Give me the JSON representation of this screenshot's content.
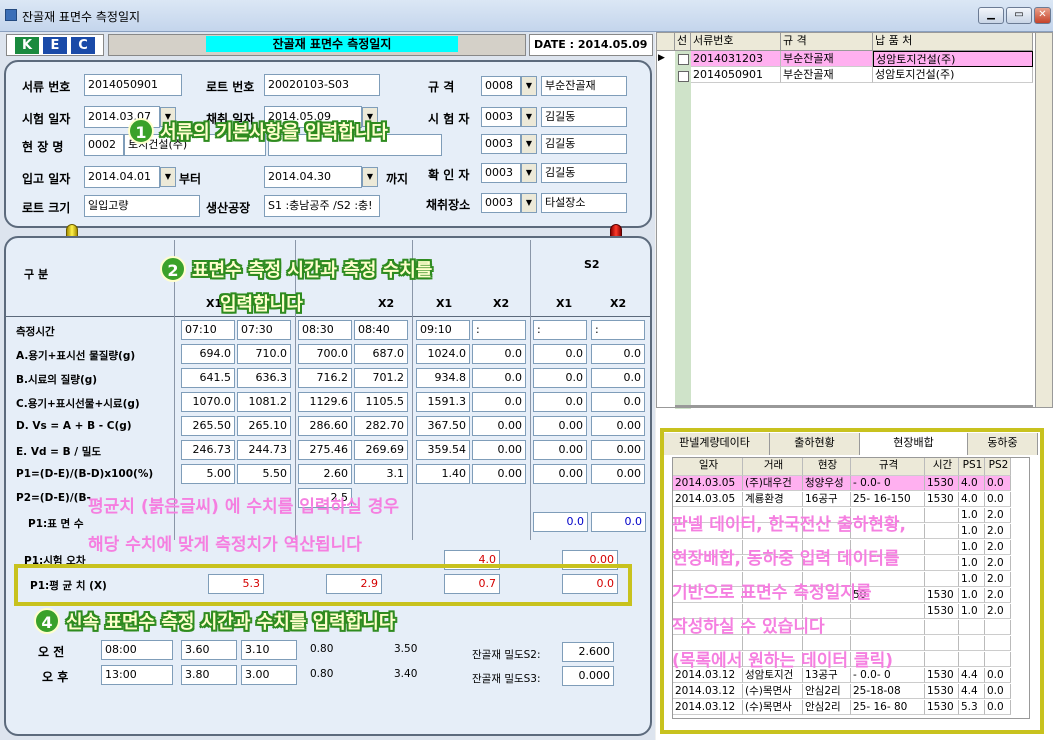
{
  "window": {
    "title": "잔골재 표면수 측정일지",
    "min": "▁",
    "max": "▭",
    "close": "✕"
  },
  "logo": {
    "k": "K",
    "e": "E",
    "c": "C",
    "colors": [
      "#1a8a3e",
      "#1a4aa8",
      "#1a4aa8"
    ]
  },
  "header": {
    "title": "잔골재 표면수 측정일지",
    "date": "DATE : 2014.05.09"
  },
  "form": {
    "doc_no_label": "서류 번호",
    "doc_no": "2014050901",
    "lot_no_label": "로트 번호",
    "lot_no": "20020103-S03",
    "spec_label": "규    격",
    "spec_code": "0008",
    "spec_name": "부순잔골재",
    "test_date_label": "시험 일자",
    "test_date": "2014.03.07",
    "cut_label": "채취 일자",
    "cut_date": "2014.05.09",
    "tester_label": "시 험 자",
    "tester_code": "0003",
    "tester_name": "김길동",
    "site_label": "현 장 명",
    "site_code": "0002",
    "site_name": "토지건설(주)",
    "checker_code": "0003",
    "checker_name": "김길동",
    "in_date_label": "입고 일자",
    "in_from": "2014.04.01",
    "from_label": "부터",
    "in_to": "2014.04.30",
    "to_label": "까지",
    "confirm_label": "확 인 자",
    "confirm_code": "0003",
    "confirm_name": "김길동",
    "lot_size_label": "로트 크기",
    "lot_size": "일입고량",
    "factory_label": "생산공장",
    "factory": "S1 :충남공주 /S2 :충!",
    "place_label": "채취장소",
    "place_code": "0003",
    "place_name": "타설장소"
  },
  "table": {
    "gubun_label": "구    분",
    "col_x1": "X1",
    "col_x2": "X2",
    "col_s": "S",
    "col_s2": "S2",
    "rows": [
      {
        "label": "측정시간",
        "v": [
          "07:10",
          "07:30",
          "08:30",
          "08:40",
          "09:10",
          ":",
          ":",
          ":"
        ]
      },
      {
        "label": "A.용기+표시선 물질량(g)",
        "v": [
          "694.0",
          "710.0",
          "700.0",
          "687.0",
          "1024.0",
          "0.0",
          "0.0",
          "0.0"
        ]
      },
      {
        "label": "B.시료의 질량(g)",
        "v": [
          "641.5",
          "636.3",
          "716.2",
          "701.2",
          "934.8",
          "0.0",
          "0.0",
          "0.0"
        ]
      },
      {
        "label": "C.용기+표시선물+시료(g)",
        "v": [
          "1070.0",
          "1081.2",
          "1129.6",
          "1105.5",
          "1591.3",
          "0.0",
          "0.0",
          "0.0"
        ]
      },
      {
        "label": "D. Vs = A + B - C(g)",
        "v": [
          "265.50",
          "265.10",
          "286.60",
          "282.70",
          "367.50",
          "0.00",
          "0.00",
          "0.00"
        ]
      },
      {
        "label": "E. Vd = B / 밀도",
        "v": [
          "246.73",
          "244.73",
          "275.46",
          "269.69",
          "359.54",
          "0.00",
          "0.00",
          "0.00"
        ]
      },
      {
        "label": "P1=(D-E)/(B-D)x100(%)",
        "v": [
          "5.00",
          "5.50",
          "2.60",
          "3.1",
          "1.40",
          "0.00",
          "0.00",
          "0.00"
        ]
      },
      {
        "label": "P2=(D-E)/(B-",
        "v": [
          "",
          "",
          "2.5",
          "",
          "",
          "",
          "",
          ""
        ]
      }
    ],
    "p1_surface_label": "P1:표 면 수",
    "p1_surface_vals": [
      "0.0",
      "0.0"
    ],
    "p1_range_label": "P1:시험 오차",
    "p1_range_vals": [
      "4.0",
      "0.00"
    ],
    "p1_avg_label": "P1:평 균 치 (X)",
    "p1_avg_vals": [
      "5.3",
      "2.9",
      "0.7",
      "0.0"
    ]
  },
  "quick": {
    "label_prefix": "신속 표면수 측정",
    "am_label": "오 전",
    "am_vals": [
      "08:00",
      "3.60",
      "3.10",
      "0.80",
      "3.50"
    ],
    "pm_label": "오 후",
    "pm_vals": [
      "13:00",
      "3.80",
      "3.00",
      "0.80",
      "3.40"
    ],
    "density_s2_label": "잔골재 밀도S2:",
    "density_s2": "2.600",
    "density_s3_label": "잔골재 밀도S3:",
    "density_s3": "0.000"
  },
  "annotations": {
    "a1": "서류의 기본사항을 입력합니다",
    "a2_line1": "표면수 측정 시간과 측정 수치를",
    "a2_line2": "입력합니다",
    "a4": "신속 표면수 측정 시간과 수치를 입력합니다",
    "n1": "1",
    "n2": "2",
    "n4": "4",
    "pink_left_1": "평균치 (붉은글씨) 에 수치를 입력하실 경우",
    "pink_left_2": "해당 수치에 맞게 측정치가 역산됩니다",
    "pink_right_1": "판넬 데이터, 한국전산 출하현황,",
    "pink_right_2": "현장배합, 동하중 입력 데이터를",
    "pink_right_3": "기반으로 표면수 측정일지를",
    "pink_right_4": "작성하실 수 있습니다",
    "pink_right_5": "(목록에서 원하는 데이터 클릭)"
  },
  "list1": {
    "headers": [
      "선",
      "서류번호",
      "규 격",
      "납 품 처"
    ],
    "rows": [
      {
        "doc": "2014031203",
        "spec": "부순잔골재",
        "dest": "성암토지건설(주)",
        "sel": true
      },
      {
        "doc": "2014050901",
        "spec": "부순잔골재",
        "dest": "성암토지건설(주)",
        "sel": false
      }
    ]
  },
  "tabs": [
    "판넬계량데이타",
    "출하현황",
    "현장배합",
    "동하중"
  ],
  "list2": {
    "headers": [
      "일자",
      "거래",
      "현장",
      "규격",
      "시간",
      "PS1",
      "PS2"
    ],
    "rows": [
      [
        "2014.03.05",
        "(주)대우건",
        "청양우성",
        "- 0.0-  0",
        "1530",
        "4.0",
        "0.0"
      ],
      [
        "2014.03.05",
        "계룡환경",
        "16공구",
        "25- 16-150",
        "1530",
        "4.0",
        "0.0"
      ],
      [
        "",
        "",
        "",
        "",
        "",
        "1.0",
        "2.0"
      ],
      [
        "",
        "",
        "",
        "",
        "",
        "1.0",
        "2.0"
      ],
      [
        "",
        "",
        "",
        "",
        "",
        "1.0",
        "2.0"
      ],
      [
        "",
        "",
        "",
        "",
        "",
        "1.0",
        "2.0"
      ],
      [
        "",
        "",
        "",
        "",
        "",
        "1.0",
        "2.0"
      ],
      [
        "",
        "",
        "",
        "50",
        "1530",
        "1.0",
        "2.0"
      ],
      [
        "",
        "",
        "",
        "",
        "1530",
        "1.0",
        "2.0"
      ],
      [
        "",
        "",
        "",
        "",
        "",
        "",
        ""
      ],
      [
        "",
        "",
        "",
        "",
        "",
        "",
        ""
      ],
      [
        "",
        "",
        "",
        "",
        "",
        "",
        ""
      ],
      [
        "2014.03.12",
        "성암토지건",
        "13공구",
        "- 0.0-  0",
        "1530",
        "4.4",
        "0.0"
      ],
      [
        "2014.03.12",
        "(수)목면사",
        "안심2리",
        "25-18-08",
        "1530",
        "4.4",
        "0.0"
      ],
      [
        "2014.03.12",
        "(수)목면사",
        "안심2리",
        "25- 16- 80",
        "1530",
        "5.3",
        "0.0"
      ]
    ]
  }
}
